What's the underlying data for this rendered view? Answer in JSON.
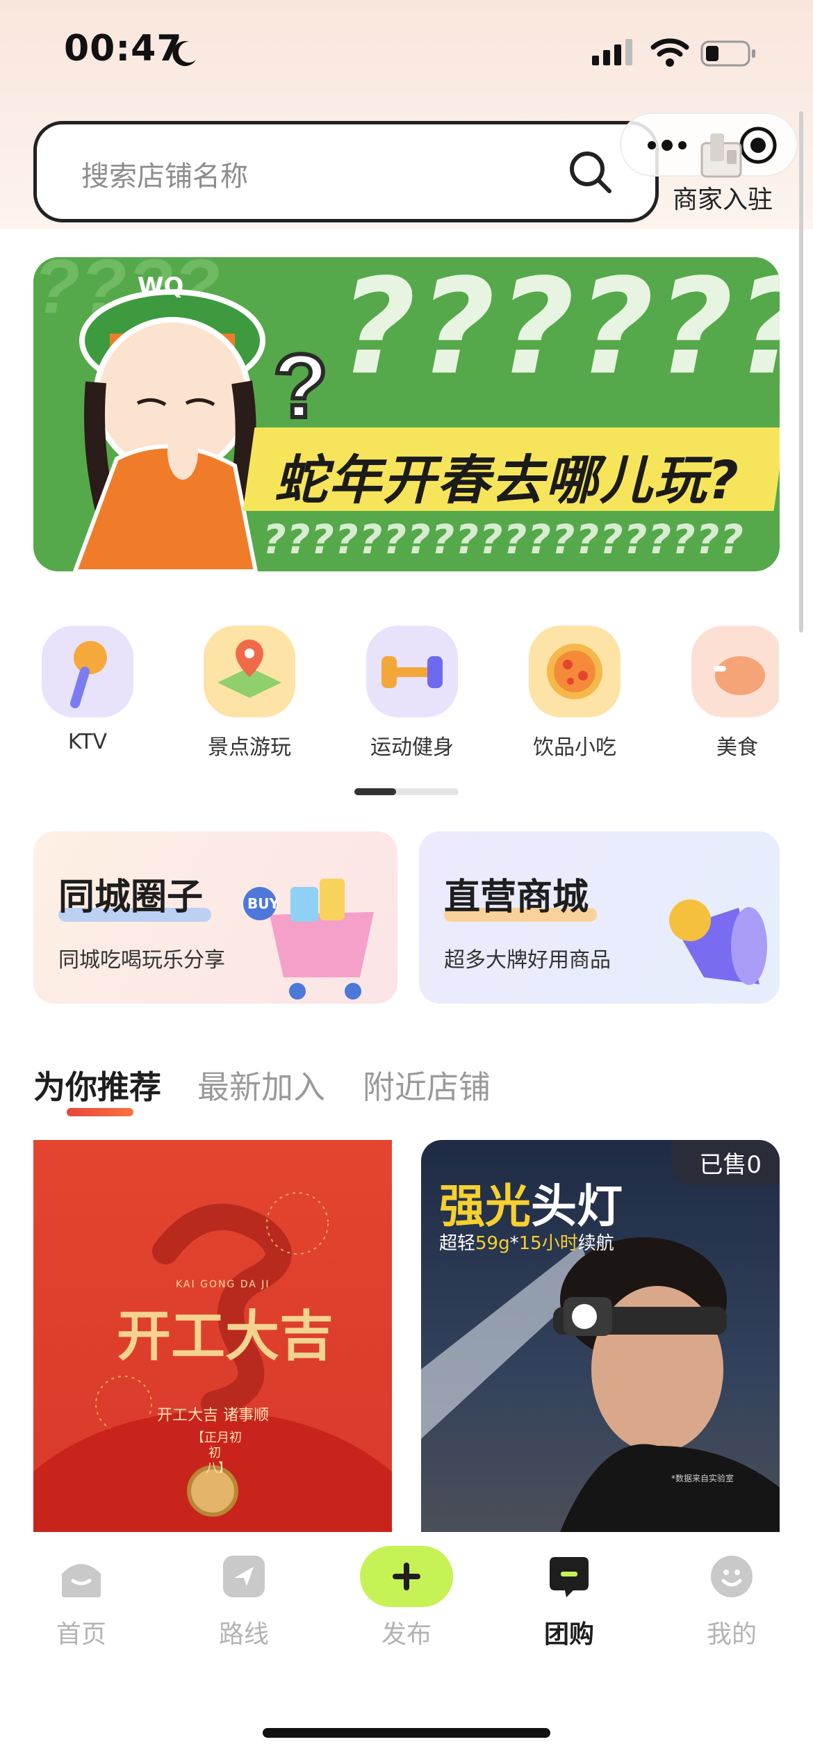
{
  "status_bar": {
    "time": "00:47"
  },
  "search": {
    "placeholder": "搜索店铺名称"
  },
  "merchant": {
    "label": "商家入驻"
  },
  "banner": {
    "cap_text": "WQ",
    "slogan": "蛇年开春去哪儿玩?",
    "big_marks": "??????",
    "small_marks": "????????????????????"
  },
  "categories": [
    {
      "label": "KTV",
      "icon": "microphone-icon",
      "color": "#e8e2fb"
    },
    {
      "label": "景点游玩",
      "icon": "map-pin-icon",
      "color": "#fde3a6"
    },
    {
      "label": "运动健身",
      "icon": "dumbbell-icon",
      "color": "#e8e2fb"
    },
    {
      "label": "饮品小吃",
      "icon": "pizza-icon",
      "color": "#fde3a6"
    },
    {
      "label": "美食",
      "icon": "roast-chicken-icon",
      "color": "#fde0d4"
    }
  ],
  "promos": [
    {
      "title": "同城圈子",
      "subtitle": "同城吃喝玩乐分享",
      "deco_text": "BUY"
    },
    {
      "title": "直营商城",
      "subtitle": "超多大牌好用商品"
    }
  ],
  "tabs": [
    "为你推荐",
    "最新加入",
    "附近店铺"
  ],
  "products": [
    {
      "title": "开工大吉",
      "pinyin": "KAI GONG DA JI",
      "line1": "开工大吉 诸事顺",
      "line2": "【正月初",
      "line3": "初",
      "line4": "八】"
    },
    {
      "sold_badge": "已售0",
      "title_a": "强光",
      "title_b": "头灯",
      "sub_a": "超轻",
      "sub_b": "59g",
      "sub_c": "*",
      "sub_d": "15小时",
      "sub_e": "续航",
      "footnote": "*数据来自实验室"
    }
  ],
  "bottom_nav": [
    {
      "label": "首页",
      "icon": "home-icon"
    },
    {
      "label": "路线",
      "icon": "route-icon"
    },
    {
      "label": "发布",
      "icon": "plus-icon"
    },
    {
      "label": "团购",
      "icon": "chat-bubble-icon",
      "active": true
    },
    {
      "label": "我的",
      "icon": "smiley-icon"
    }
  ],
  "colors": {
    "accent_green": "#c7f256",
    "banner_green": "#55a94a",
    "slogan_yellow": "#f6e55a",
    "tab_underline": "#e8453c"
  }
}
